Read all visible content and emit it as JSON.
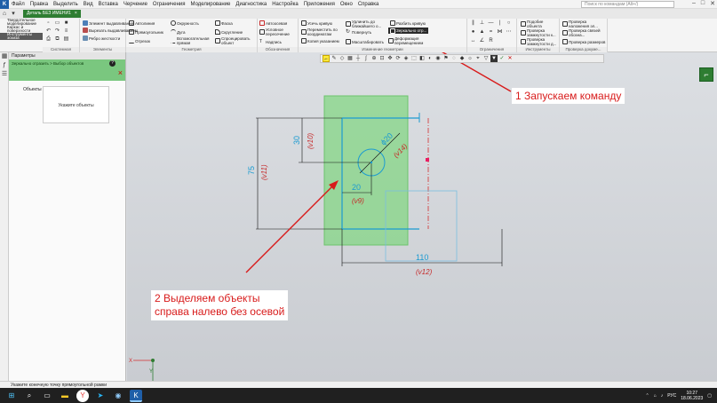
{
  "menubar": {
    "items": [
      "Файл",
      "Правка",
      "Выделить",
      "Вид",
      "Вставка",
      "Черчение",
      "Ограничения",
      "Моделирование",
      "Диагностика",
      "Настройка",
      "Приложения",
      "Окно",
      "Справка"
    ],
    "search_placeholder": "Поиск по командам (Alt+/)"
  },
  "tabs": {
    "document_tab": "Деталь БЕЗ ИМЕНИ1",
    "document_close": "×"
  },
  "ribbon": {
    "left_stack": [
      "Твердотельное моделирование",
      "Каркас и поверхности",
      "Инструменты эскиза"
    ],
    "groups": [
      {
        "label": "Системная"
      },
      {
        "label": "Элементы"
      },
      {
        "label": "Геометрия"
      },
      {
        "label": "Обозначения"
      },
      {
        "label": "Изменение геометрии"
      },
      {
        "label": "Ограничения"
      },
      {
        "label": "Инструменты"
      },
      {
        "label": "Проверка докумe..."
      }
    ],
    "elements_items": [
      "Элемент выдавливания",
      "Вырезать выдавливанием",
      "Ребро жесткости"
    ],
    "geometry_items": [
      "Автолиния",
      "Окружность",
      "Фаска",
      "Прямоугольник",
      "Дуга",
      "Скругление",
      "Отрезок",
      "Вспомогательная прямая",
      "Спроецировать объект"
    ],
    "designation_items": [
      "Автоосевая",
      "Условное пересечение",
      "Надпись"
    ],
    "edit_items": [
      "Усечь кривую",
      "Удлинить до ближайшего о...",
      "Разбить кривую",
      "Переместить по координатам",
      "Повернуть",
      "Копия указанием",
      "Масштабировать",
      "Деформация перемещением"
    ],
    "edit_tooltip": "Зеркально отр...",
    "tools_items": [
      "Подобие объекта",
      "Проверка замкнутости к...",
      "Проверка замкнутости д..."
    ],
    "check_items": [
      "Проверка наложения эл...",
      "Проверка связей обозна...",
      "Проверка размеров"
    ]
  },
  "params_panel": {
    "title": "Параметры",
    "breadcrumb": "Зеркально отразить > Выбор объектов",
    "objects_label": "Объекты",
    "objects_hint": "Укажите объекты",
    "help": "?",
    "close": "×"
  },
  "drawing": {
    "dim_30": "30",
    "dim_v10": "(v10)",
    "dim_75": "75",
    "dim_v11": "(v11)",
    "dim_phi20": "ϕ20",
    "dim_v14": "(v14)",
    "dim_20": "20",
    "dim_v9": "(v9)",
    "dim_110": "110",
    "dim_v12": "(v12)",
    "axis_x": "X",
    "axis_y": "Y"
  },
  "annotations": {
    "step1": "1 Запускаем команду",
    "step2_line1": "2 Выделяем объекты",
    "step2_line2": "справа налево без осевой"
  },
  "statusbar": {
    "text": "Укажите конечную точку прямоугольной рамки"
  },
  "taskbar": {
    "lang": "РУС",
    "time": "10:27",
    "date": "18.06.2023"
  },
  "colors": {
    "accent_green": "#2e7d32",
    "selection_green": "#7fd67f",
    "annotation_red": "#d81b1b",
    "sketch_blue": "#1b9bd1",
    "dim_red": "#c62828"
  }
}
